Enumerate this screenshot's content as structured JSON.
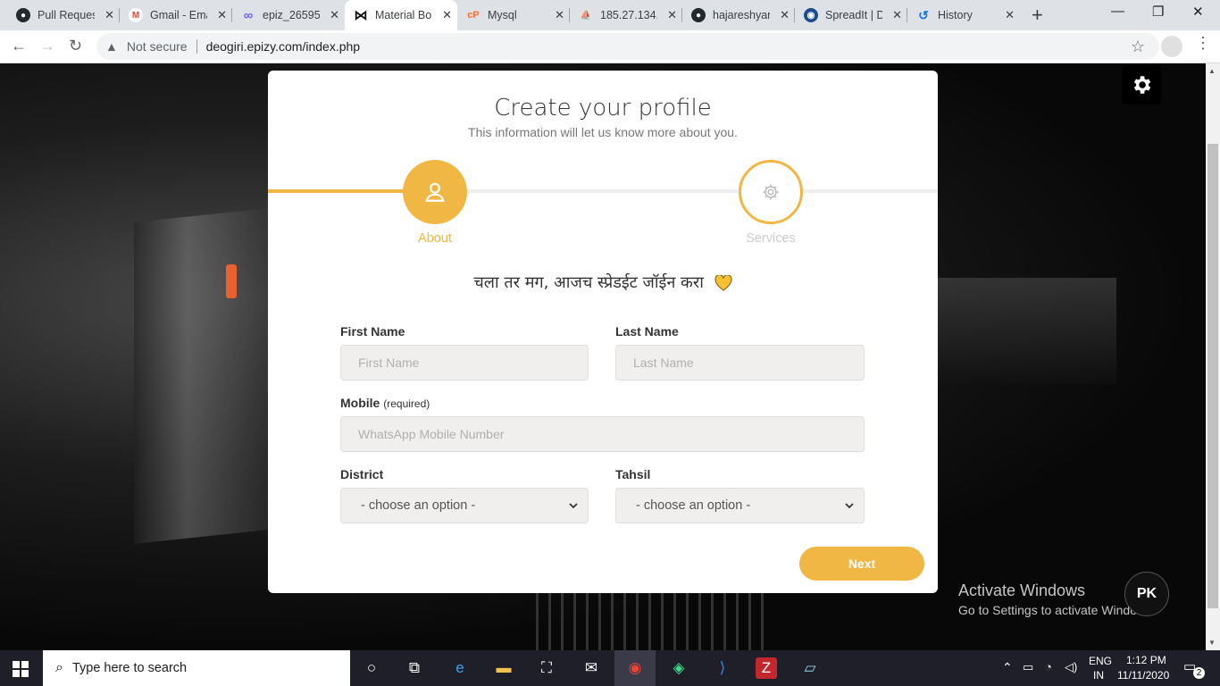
{
  "browser": {
    "tabs": [
      {
        "title": "Pull Reques",
        "icon": "github-icon",
        "icon_color": "#24292e",
        "icon_glyph": "●"
      },
      {
        "title": "Gmail - Ema",
        "icon": "gmail-icon",
        "icon_color": "#ea4335",
        "icon_glyph": "M"
      },
      {
        "title": "epiz_26595",
        "icon": "infinity-icon",
        "icon_color": "#6c63ff",
        "icon_glyph": "∞"
      },
      {
        "title": "Material Bo",
        "icon": "bow-icon",
        "icon_color": "#111111",
        "icon_glyph": "⋈"
      },
      {
        "title": "Mysql",
        "icon": "cpanel-icon",
        "icon_color": "#ff6c2c",
        "icon_glyph": "cP"
      },
      {
        "title": "185.27.134.",
        "icon": "phpmyadmin-icon",
        "icon_color": "#f89c0e",
        "icon_glyph": "⛵"
      },
      {
        "title": "hajareshyan",
        "icon": "github-icon",
        "icon_color": "#24292e",
        "icon_glyph": "●"
      },
      {
        "title": "SpreadIt | D",
        "icon": "spreadit-icon",
        "icon_color": "#1a4d8f",
        "icon_glyph": "◉"
      },
      {
        "title": "History",
        "icon": "history-icon",
        "icon_color": "#1a73e8",
        "icon_glyph": "↺"
      }
    ],
    "active_tab_index": 3,
    "security_label": "Not secure",
    "url": "deogiri.epizy.com/index.php"
  },
  "page": {
    "title": "Create your profile",
    "subtitle": "This information will let us know more about you.",
    "steps": [
      {
        "label": "About",
        "icon": "user-icon",
        "active": true
      },
      {
        "label": "Services",
        "icon": "settings-icon",
        "active": false
      }
    ],
    "progress_fraction": 0.25,
    "slogan": "चला तर मग, आजच स्प्रेडईट जॉईन करा",
    "form": {
      "first_name": {
        "label": "First Name",
        "placeholder": "First Name"
      },
      "last_name": {
        "label": "Last Name",
        "placeholder": "Last Name"
      },
      "mobile": {
        "label": "Mobile",
        "label_note": "(required)",
        "placeholder": "WhatsApp Mobile Number"
      },
      "district": {
        "label": "District",
        "selected": "- choose an option -"
      },
      "tahsil": {
        "label": "Tahsil",
        "selected": "- choose an option -"
      }
    },
    "next_label": "Next",
    "accent_color": "#f0b744"
  },
  "watermark": {
    "line1": "Activate Windows",
    "line2": "Go to Settings to activate Windows.",
    "avatar": "PK"
  },
  "taskbar": {
    "search_placeholder": "Type here to search",
    "lang_top": "ENG",
    "lang_bottom": "IN",
    "time": "1:12 PM",
    "date": "11/11/2020",
    "notification_count": "2"
  }
}
